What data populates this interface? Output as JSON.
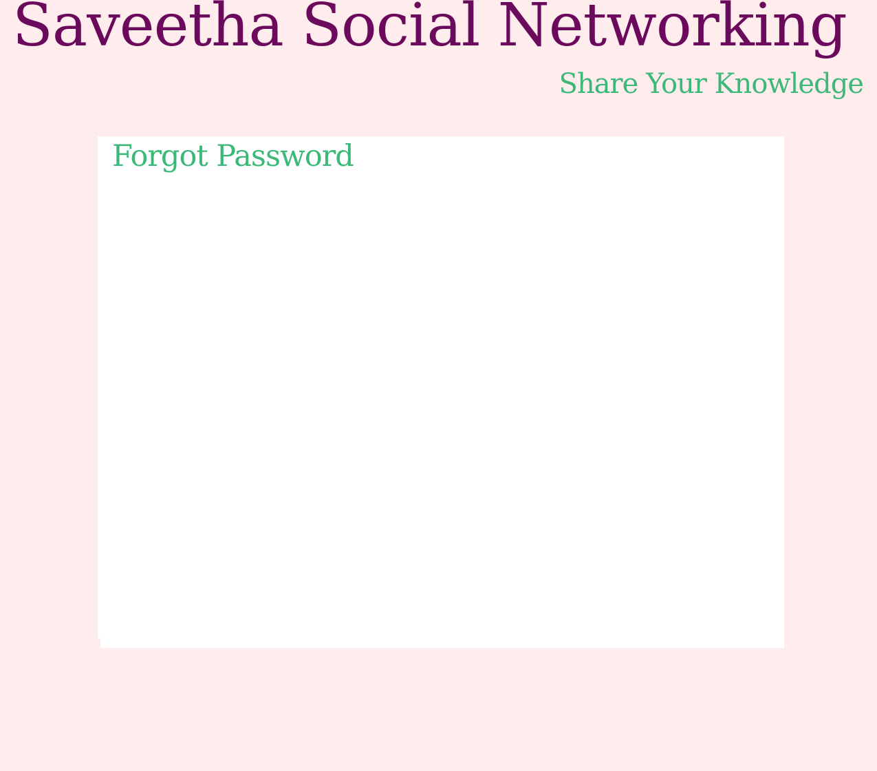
{
  "header": {
    "title": "Saveetha Social Networking",
    "tagline": "Share Your Knowledge"
  },
  "panel": {
    "title": "Forgot Password"
  },
  "colors": {
    "background": "#ffeced",
    "title": "#6b0a5c",
    "accent": "#3cb878",
    "panel": "#ffffff"
  }
}
